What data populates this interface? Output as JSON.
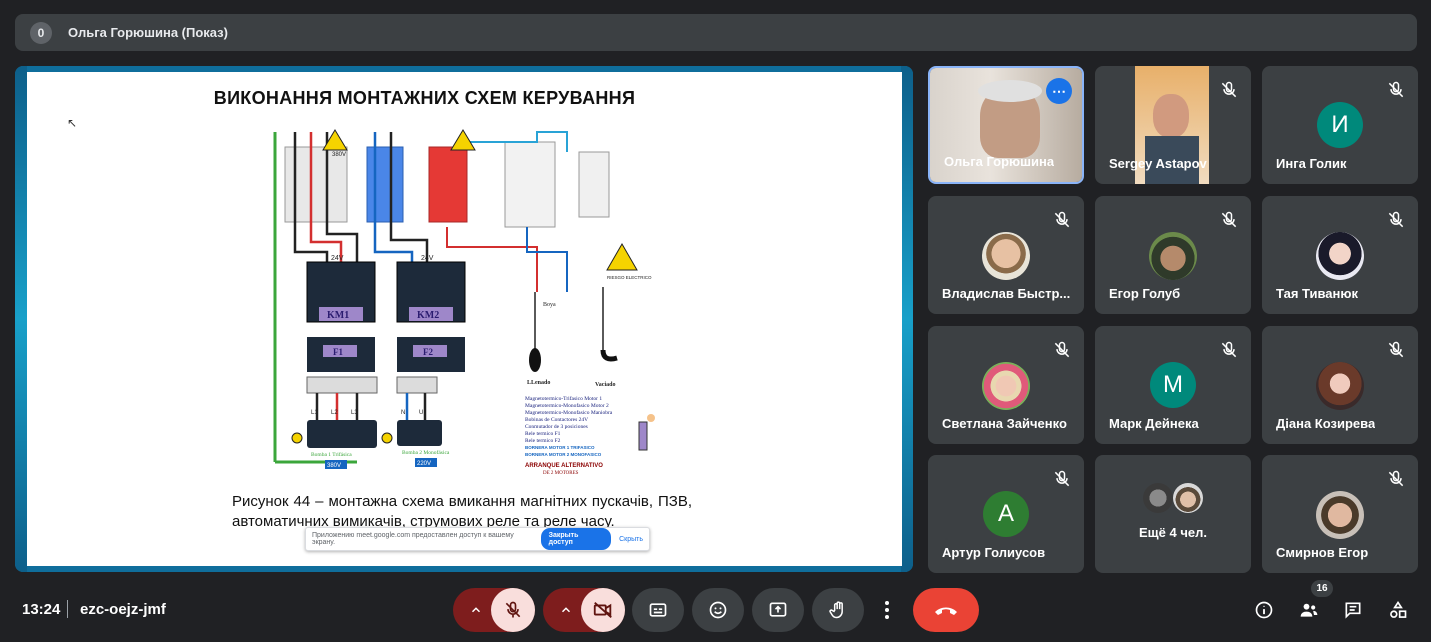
{
  "topbar": {
    "badge": "0",
    "presenter": "Ольга Горюшина (Показ)"
  },
  "slide": {
    "title": "ВИКОНАННЯ МОНТАЖНИХ  СХЕМ КЕРУВАННЯ",
    "caption": "Рисунок 44 – монтажна схема вмикання магнітних пускачів, ПЗВ, автоматичних вимикачів, струмових реле та  реле часу.",
    "share_text": "Приложению meet.google.com предоставлен доступ к вашему экрану.",
    "share_accept": "Закрыть доступ",
    "share_hide": "Скрыть",
    "diagram": {
      "v380": "380V",
      "v24a": "24V",
      "v24b": "24V",
      "km1": "KM1",
      "km2": "KM2",
      "f1": "F1",
      "f2": "F2",
      "boya": "Boya",
      "llenado": "LLenado",
      "vaciado": "Vaciado",
      "riesgo": "RIESGO ELECTRICO",
      "legend": [
        "Magnetotermico-Trifasico  Motor 1",
        "Magnetotermico-Monofasico Motor 2",
        "Magnetotermico-Monofasico Maniobra",
        "Bobinas de Contactores 24V",
        "Conmutador de 3 posiciones",
        "Rele termico F1",
        "Rele termico F2",
        "BORNERA MOTOR 1 TRIFASICO",
        "BORNERA MOTOR 2 MONOFASICO"
      ],
      "arranque": "ARRANQUE ALTERNATIVO",
      "motores": "DE 2 MOTORES",
      "bomba1": "Bomba 1 Trifásica",
      "bomba1_v": "380V",
      "bomba2": "Bomba 2 Monofásica",
      "bomba2_v": "220V",
      "l1": "L1",
      "l2": "L2",
      "l3": "L3",
      "n": "N",
      "u": "U"
    }
  },
  "participants": [
    {
      "name": "Ольга Горюшина",
      "type": "video",
      "active": true
    },
    {
      "name": "Sergey Astapov",
      "type": "video",
      "muted": true
    },
    {
      "name": "Инга Голик",
      "initial": "И",
      "color": "#00897b",
      "muted": true
    },
    {
      "name": "Владислав Быстр...",
      "type": "photo",
      "muted": true
    },
    {
      "name": "Егор Голуб",
      "type": "photo",
      "muted": true
    },
    {
      "name": "Тая Тиванюк",
      "type": "photo",
      "muted": true
    },
    {
      "name": "Светлана Зайченко",
      "type": "photo",
      "muted": true
    },
    {
      "name": "Марк Дейнека",
      "initial": "М",
      "color": "#00897b",
      "muted": true
    },
    {
      "name": "Діана Козирева",
      "type": "photo",
      "muted": true
    },
    {
      "name": "Артур Голиусов",
      "initial": "А",
      "color": "#2e7d32",
      "muted": true
    },
    {
      "name": "Ещё 4 чел.",
      "type": "more"
    },
    {
      "name": "Смирнов Егор",
      "type": "photo",
      "muted": true
    }
  ],
  "bottombar": {
    "time": "13:24",
    "meeting_code": "ezc-oejz-jmf",
    "people_count": "16"
  }
}
